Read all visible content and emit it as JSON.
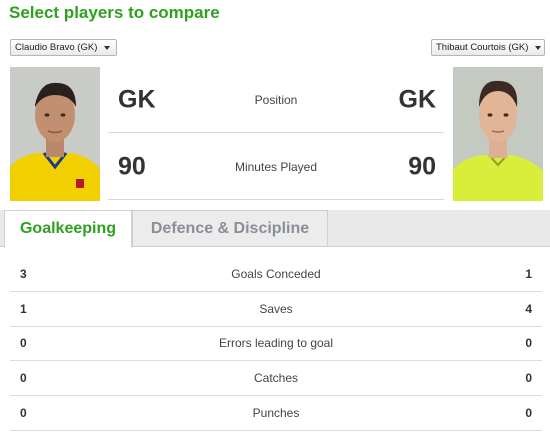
{
  "header": {
    "title": "Select players to compare"
  },
  "players": {
    "left": {
      "selected": "Claudio Bravo (GK)",
      "position": "GK",
      "minutes": "90",
      "kit_color": "#f5d000"
    },
    "right": {
      "selected": "Thibaut Courtois (GK)",
      "position": "GK",
      "minutes": "90",
      "kit_color": "#d9ef3a"
    }
  },
  "comparison": {
    "position_label": "Position",
    "minutes_label": "Minutes Played"
  },
  "tabs": [
    {
      "label": "Goalkeeping",
      "active": true
    },
    {
      "label": "Defence & Discipline",
      "active": false
    }
  ],
  "stats": [
    {
      "label": "Goals Conceded",
      "left": "3",
      "right": "1"
    },
    {
      "label": "Saves",
      "left": "1",
      "right": "4"
    },
    {
      "label": "Errors leading to goal",
      "left": "0",
      "right": "0"
    },
    {
      "label": "Catches",
      "left": "0",
      "right": "0"
    },
    {
      "label": "Punches",
      "left": "0",
      "right": "0"
    }
  ],
  "colors": {
    "accent": "#2fa01f",
    "inactive_tab_text": "#8a8f98"
  },
  "icons": {
    "dropdown": "chevron-down-icon"
  }
}
